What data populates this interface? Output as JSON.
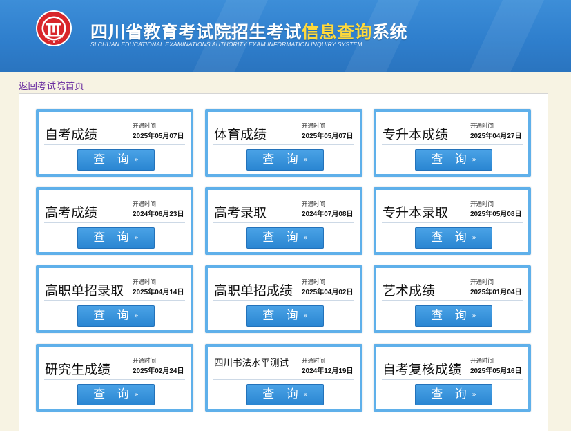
{
  "header": {
    "title_part1": "四川省教育考试院招生考试",
    "title_highlight": "信息查询",
    "title_part2": "系统",
    "subtitle": "SI CHUAN EDUCATIONAL EXAMINATIONS AUTHORITY EXAM INFORMATION INQUIRY SYSTEM"
  },
  "back_link": "返回考试院首页",
  "cards": [
    {
      "name": "自考成绩",
      "open_label": "开通时间",
      "date": "2025年05月07日",
      "button": "查 询",
      "arrow": "»"
    },
    {
      "name": "体育成绩",
      "open_label": "开通时间",
      "date": "2025年05月07日",
      "button": "查 询",
      "arrow": "»"
    },
    {
      "name": "专升本成绩",
      "open_label": "开通时间",
      "date": "2025年04月27日",
      "button": "查 询",
      "arrow": "»"
    },
    {
      "name": "高考成绩",
      "open_label": "开通时间",
      "date": "2024年06月23日",
      "button": "查 询",
      "arrow": "»"
    },
    {
      "name": "高考录取",
      "open_label": "开通时间",
      "date": "2024年07月08日",
      "button": "查 询",
      "arrow": "»"
    },
    {
      "name": "专升本录取",
      "open_label": "开通时间",
      "date": "2025年05月08日",
      "button": "查 询",
      "arrow": "»"
    },
    {
      "name": "高职单招录取",
      "open_label": "开通时间",
      "date": "2025年04月14日",
      "button": "查 询",
      "arrow": "»"
    },
    {
      "name": "高职单招成绩",
      "open_label": "开通时间",
      "date": "2025年04月02日",
      "button": "查 询",
      "arrow": "»"
    },
    {
      "name": "艺术成绩",
      "open_label": "开通时间",
      "date": "2025年01月04日",
      "button": "查 询",
      "arrow": "»"
    },
    {
      "name": "研究生成绩",
      "open_label": "开通时间",
      "date": "2025年02月24日",
      "button": "查 询",
      "arrow": "»"
    },
    {
      "name": "四川书法水平测试",
      "open_label": "开通时间",
      "date": "2024年12月19日",
      "button": "查 询",
      "arrow": "»"
    },
    {
      "name": "自考复核成绩",
      "open_label": "开通时间",
      "date": "2025年05月16日",
      "button": "查 询",
      "arrow": "»"
    }
  ],
  "colors": {
    "header_blue": "#2f7fcd",
    "title_highlight": "#ffd93b",
    "card_border": "#5fb0ea",
    "button_blue": "#2a86d2",
    "logo_red": "#d8262b",
    "link_purple": "#6a2ca0"
  }
}
